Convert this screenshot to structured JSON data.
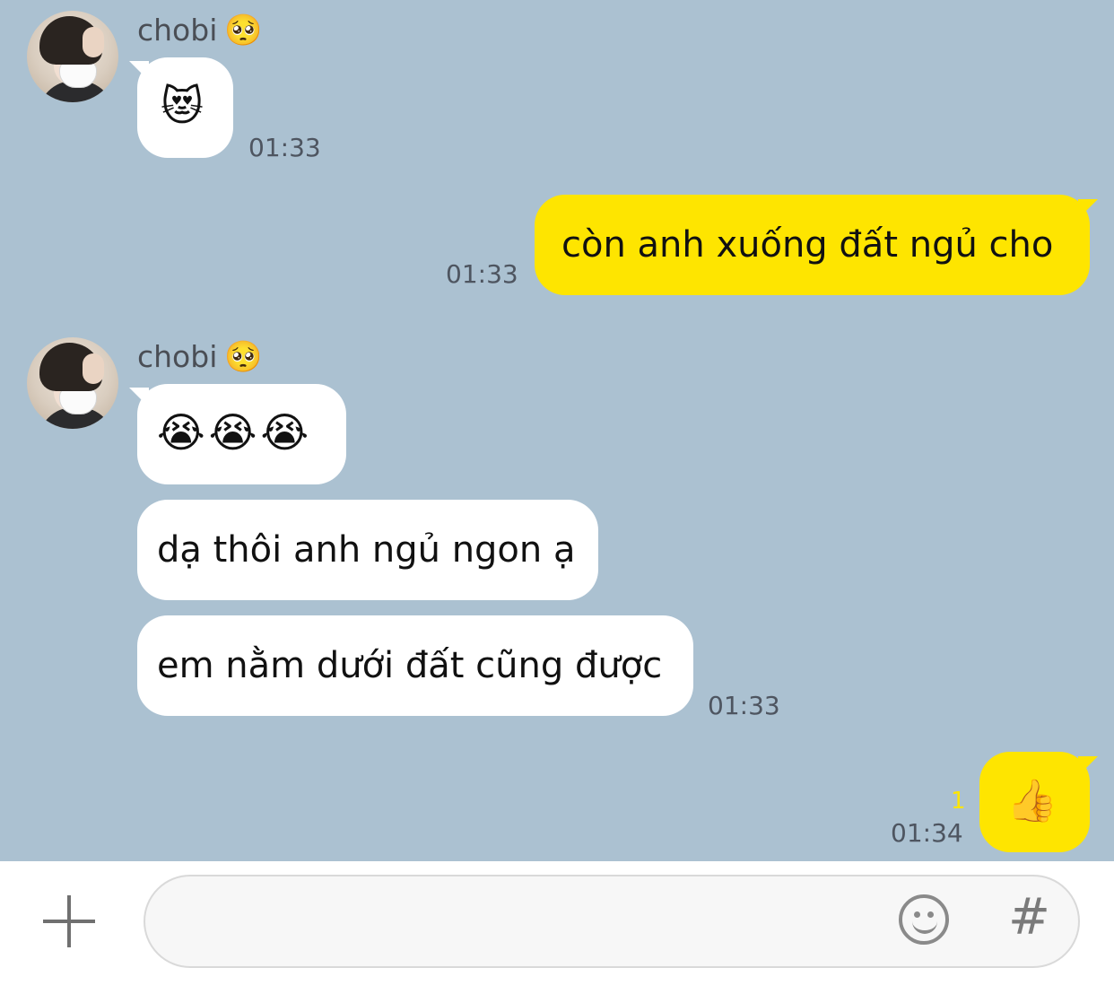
{
  "contact": {
    "name": "chobi",
    "name_emoji": "🥺"
  },
  "messages": [
    {
      "text": "😻",
      "time": "01:33"
    },
    {
      "text": "còn anh xuống đất ngủ cho",
      "time": "01:33"
    },
    {
      "text": "😭😭😭"
    },
    {
      "text": "dạ thôi anh ngủ ngon ạ"
    },
    {
      "text": "em nằm dưới đất cũng được",
      "time": "01:33"
    },
    {
      "text": "👍",
      "time": "01:34",
      "unread_count": "1"
    }
  ],
  "composer": {
    "plus_icon": "plus-icon",
    "emoji_icon": "emoji-icon",
    "hash_label": "#",
    "input_value": ""
  },
  "colors": {
    "chat_background": "#abc1d1",
    "outgoing_bubble": "#fee500",
    "incoming_bubble": "#ffffff",
    "unread_count": "#fee500"
  }
}
